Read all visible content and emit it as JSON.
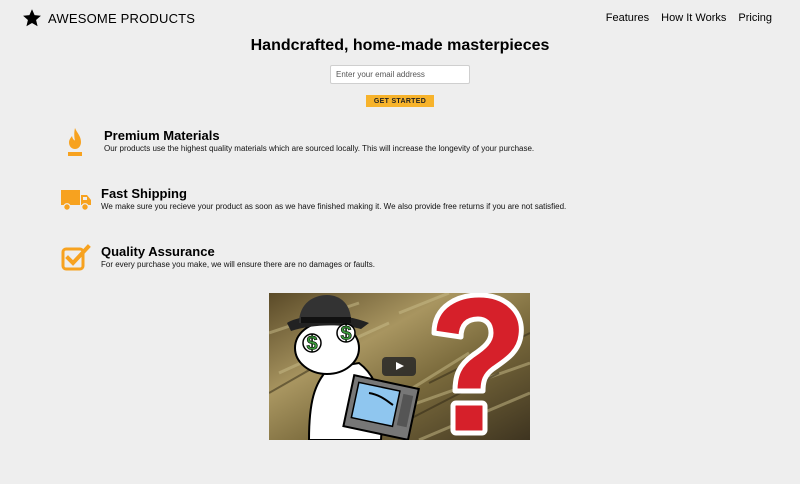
{
  "header": {
    "brand": "AWESOME PRODUCTS",
    "nav": [
      "Features",
      "How It Works",
      "Pricing"
    ]
  },
  "hero": {
    "title": "Handcrafted, home-made masterpieces",
    "email_placeholder": "Enter your email address",
    "cta_label": "GET STARTED"
  },
  "features": [
    {
      "icon": "fire-icon",
      "title": "Premium Materials",
      "text": "Our products use the highest quality materials which are sourced locally. This will increase the longevity of your purchase."
    },
    {
      "icon": "truck-icon",
      "title": "Fast Shipping",
      "text": "We make sure you recieve your product as soon as we have finished making it. We also provide free returns if you are not satisfied."
    },
    {
      "icon": "checkbox-icon",
      "title": "Quality Assurance",
      "text": "For every purchase you make, we will ensure there are no damages or faults."
    }
  ],
  "colors": {
    "accent": "#f7a21f",
    "cta": "#f7b32b",
    "background": "#eeeeee"
  },
  "video": {
    "icon": "play-icon"
  }
}
